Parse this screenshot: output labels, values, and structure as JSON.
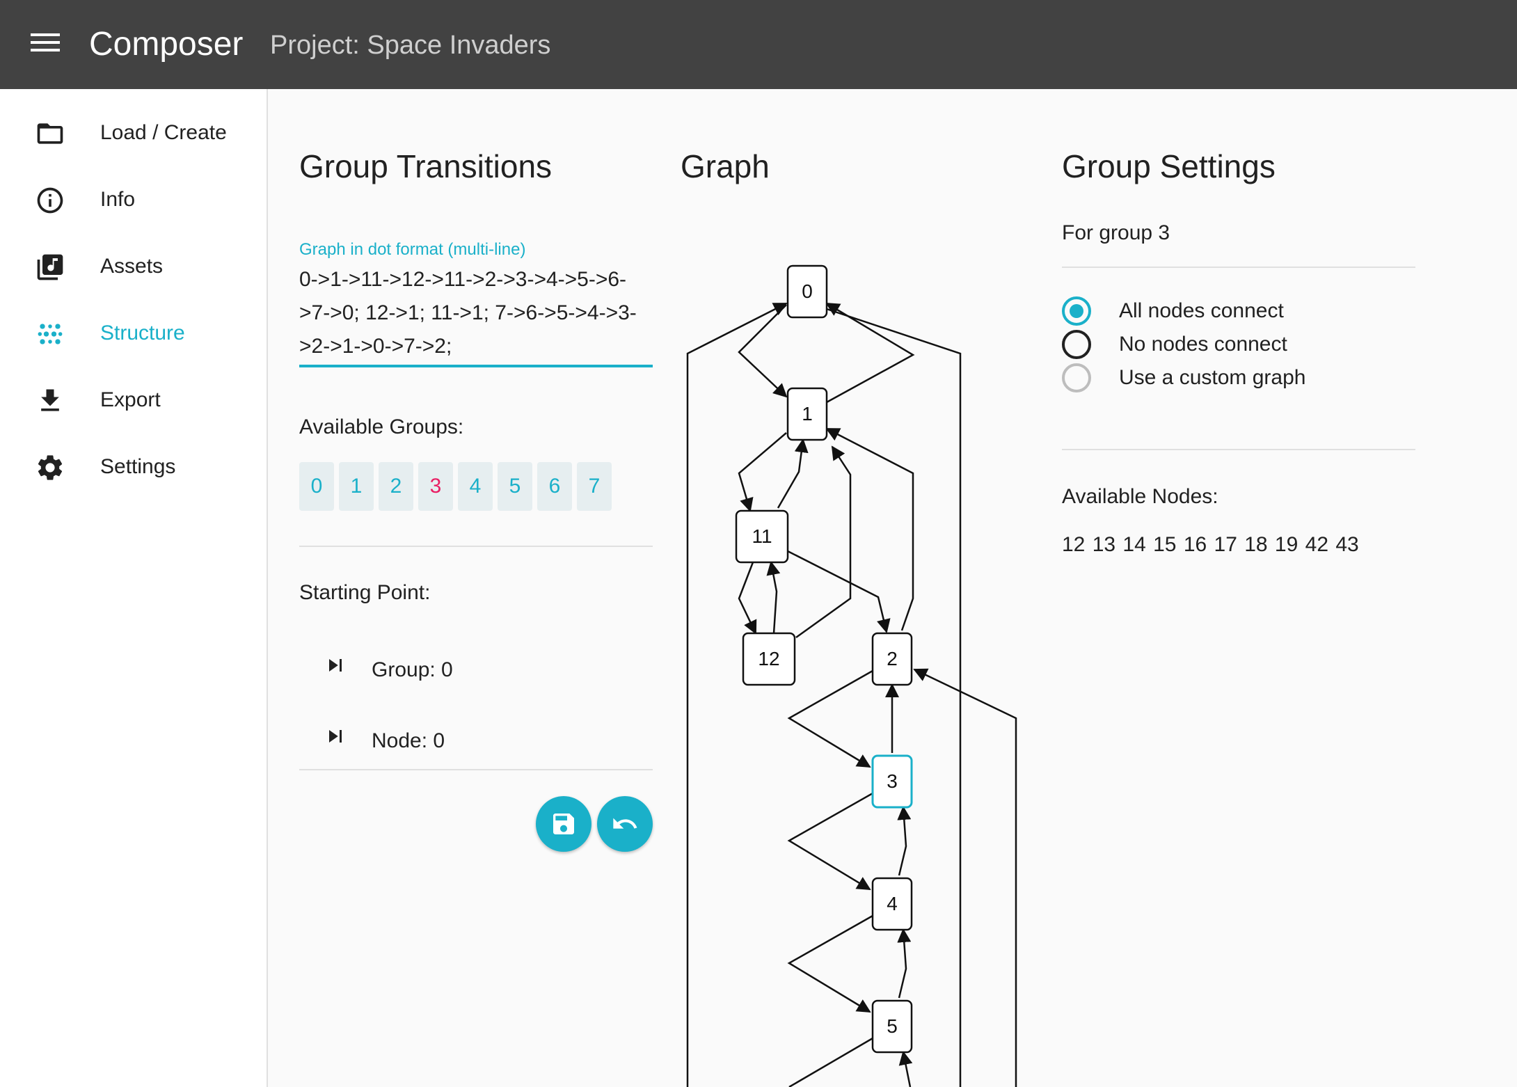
{
  "header": {
    "app_title": "Composer",
    "project_title": "Project: Space Invaders"
  },
  "sidebar": {
    "items": [
      {
        "label": "Load / Create",
        "icon": "folder-icon",
        "active": false
      },
      {
        "label": "Info",
        "icon": "info-icon",
        "active": false
      },
      {
        "label": "Assets",
        "icon": "music-library-icon",
        "active": false
      },
      {
        "label": "Structure",
        "icon": "structure-dots-icon",
        "active": true
      },
      {
        "label": "Export",
        "icon": "download-icon",
        "active": false
      },
      {
        "label": "Settings",
        "icon": "gear-icon",
        "active": false
      }
    ]
  },
  "transitions": {
    "title": "Group Transitions",
    "field_label": "Graph in dot format (multi-line)",
    "field_value": "0->1->11->12->11->2->3->4->5->6->7->0; 12->1; 11->1; 7->6->5->4->3->2->1->0->7->2;",
    "available_groups_label": "Available Groups:",
    "groups": [
      "0",
      "1",
      "2",
      "3",
      "4",
      "5",
      "6",
      "7"
    ],
    "selected_group": "3",
    "starting_point_label": "Starting Point:",
    "start_group": "Group: 0",
    "start_node": "Node: 0"
  },
  "graph": {
    "title": "Graph",
    "nodes": [
      "0",
      "1",
      "11",
      "12",
      "2",
      "3",
      "4",
      "5"
    ],
    "highlighted_node": "3"
  },
  "settings": {
    "title": "Group Settings",
    "for_group": "For group 3",
    "options": [
      "All nodes connect",
      "No nodes connect",
      "Use a custom graph"
    ],
    "selected_option": "All nodes connect",
    "available_nodes_label": "Available Nodes:",
    "available_nodes": "12 13 14 15 16 17 18 19 42 43"
  },
  "colors": {
    "accent": "#1ab0c9",
    "selected_chip": "#e91e63",
    "topbar": "#424242"
  }
}
